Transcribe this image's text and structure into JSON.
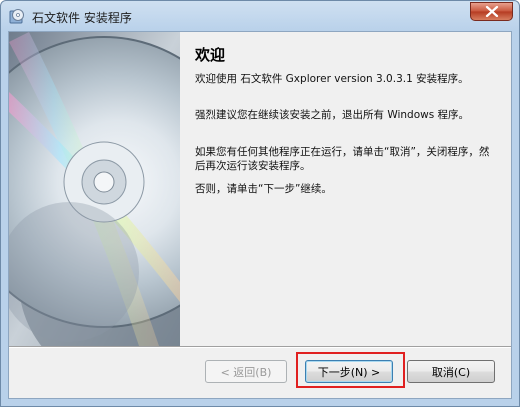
{
  "window": {
    "title": "石文软件 安装程序",
    "icon": "installer-cd-icon",
    "close_icon": "close-icon",
    "accent": "#c8553b"
  },
  "content": {
    "heading": "欢迎",
    "paragraphs": [
      "欢迎使用 石文软件 Gxplorer version 3.0.3.1 安装程序。",
      "强烈建议您在继续该安装之前，退出所有 Windows 程序。",
      "如果您有任何其他程序正在运行，请单击“取消”，关闭程序，然后再次运行该安装程序。",
      "否则，请单击“下一步”继续。"
    ]
  },
  "buttons": {
    "back": "< 返回(B)",
    "next": "下一步(N) >",
    "cancel": "取消(C)"
  },
  "highlight_color": "#e02020"
}
